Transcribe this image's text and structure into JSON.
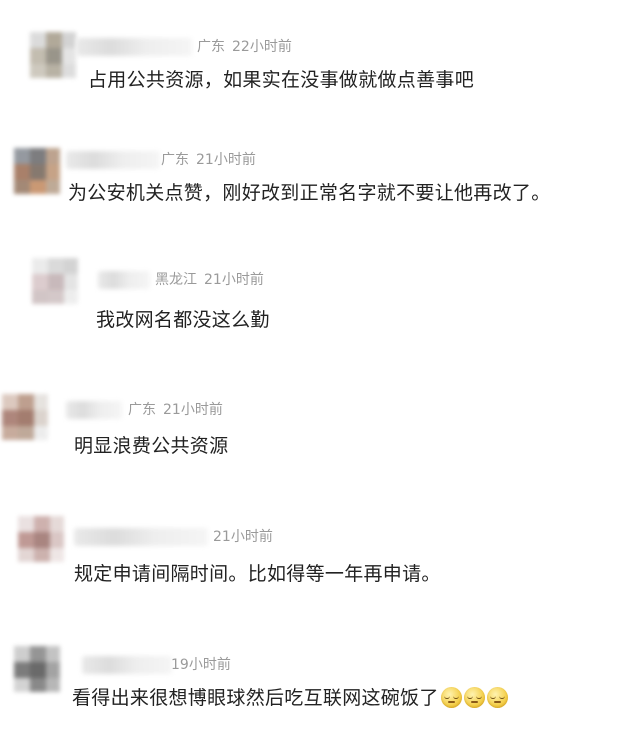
{
  "comments": [
    {
      "location": "广东",
      "time": "22小时前",
      "text": "占用公共资源，如果实在没事做就做点善事吧",
      "emojis": [],
      "avatar_colors": [
        "#d8d8d8",
        "#a9a08f",
        "#cfcfcf",
        "#bdb6a8",
        "#8f8a7e",
        "#e2e2e2",
        "#c9c4b8",
        "#b1aa9b",
        "#dadada"
      ]
    },
    {
      "location": "广东",
      "time": "21小时前",
      "text": "为公安机关点赞，刚好改到正常名字就不要让他再改了。",
      "emojis": [],
      "avatar_colors": [
        "#8a8f96",
        "#6f6f72",
        "#b69a83",
        "#a0735a",
        "#7a6b60",
        "#c09a7b",
        "#9a7d68",
        "#c58e66",
        "#b8a18c"
      ]
    },
    {
      "location": "黑龙江",
      "time": "21小时前",
      "text": "我改网名都没这么勤",
      "emojis": [],
      "avatar_colors": [
        "#e9e9e9",
        "#d6d6d6",
        "#cfcfcf",
        "#d9c7c9",
        "#c3b2b4",
        "#e2e2e2",
        "#cdbfc0",
        "#d0c3c4",
        "#ececec"
      ]
    },
    {
      "location": "广东",
      "time": "21小时前",
      "text": "明显浪费公共资源",
      "emojis": [],
      "avatar_colors": [
        "#d9c4b9",
        "#b79583",
        "#e4e0dc",
        "#a67a6e",
        "#9a6f60",
        "#d8cfc8",
        "#c2a393",
        "#b9a08f",
        "#ebebeb"
      ]
    },
    {
      "location": "",
      "time": "21小时前",
      "text": "规定申请间隔时间。比如得等一年再申请。",
      "emojis": [],
      "avatar_colors": [
        "#e8dede",
        "#c9a9a6",
        "#e3d6d4",
        "#b98f8a",
        "#a07873",
        "#d6c1bf",
        "#e0d2d0",
        "#c7aaa6",
        "#ede4e3"
      ]
    },
    {
      "location": "",
      "time": "19小时前",
      "text": "看得出来很想博眼球然后吃互联网这碗饭了",
      "emojis": [
        "face-exhaling",
        "face-exhaling",
        "face-exhaling"
      ],
      "avatar_colors": [
        "#c9c9c9",
        "#8a8a8a",
        "#bdbdbd",
        "#6e6e6e",
        "#5a5a5a",
        "#9a9a9a",
        "#cfcfcf",
        "#7d7d7d",
        "#b0b0b0"
      ]
    }
  ]
}
